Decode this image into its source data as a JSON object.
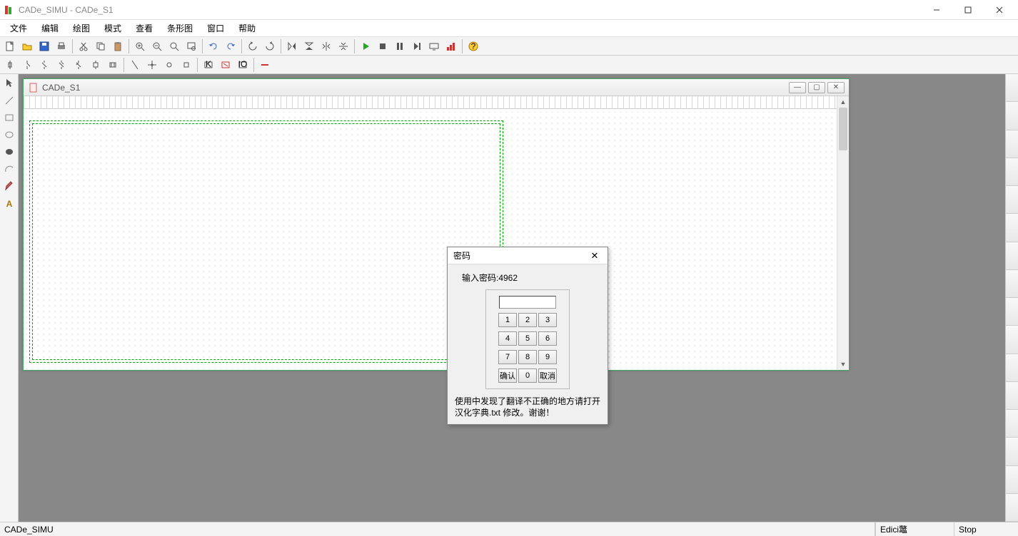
{
  "window": {
    "title": "CADe_SIMU - CADe_S1"
  },
  "menu": {
    "file": "文件",
    "edit": "编辑",
    "draw": "绘图",
    "mode": "模式",
    "view": "查看",
    "barchart": "条形图",
    "window_": "窗口",
    "help": "帮助"
  },
  "doc": {
    "name": "CADe_S1"
  },
  "dialog": {
    "title": "密码",
    "prompt": "输入密码:4962",
    "k1": "1",
    "k2": "2",
    "k3": "3",
    "k4": "4",
    "k5": "5",
    "k6": "6",
    "k7": "7",
    "k8": "8",
    "k9": "9",
    "k0": "0",
    "ok": "确认",
    "cancel": "取消",
    "note": "使用中发现了翻译不正确的地方请打开汉化字典.txt 修改。谢谢！"
  },
  "status": {
    "left": "CADe_SIMU",
    "mid": "Edici鼈",
    "right": "Stop"
  }
}
